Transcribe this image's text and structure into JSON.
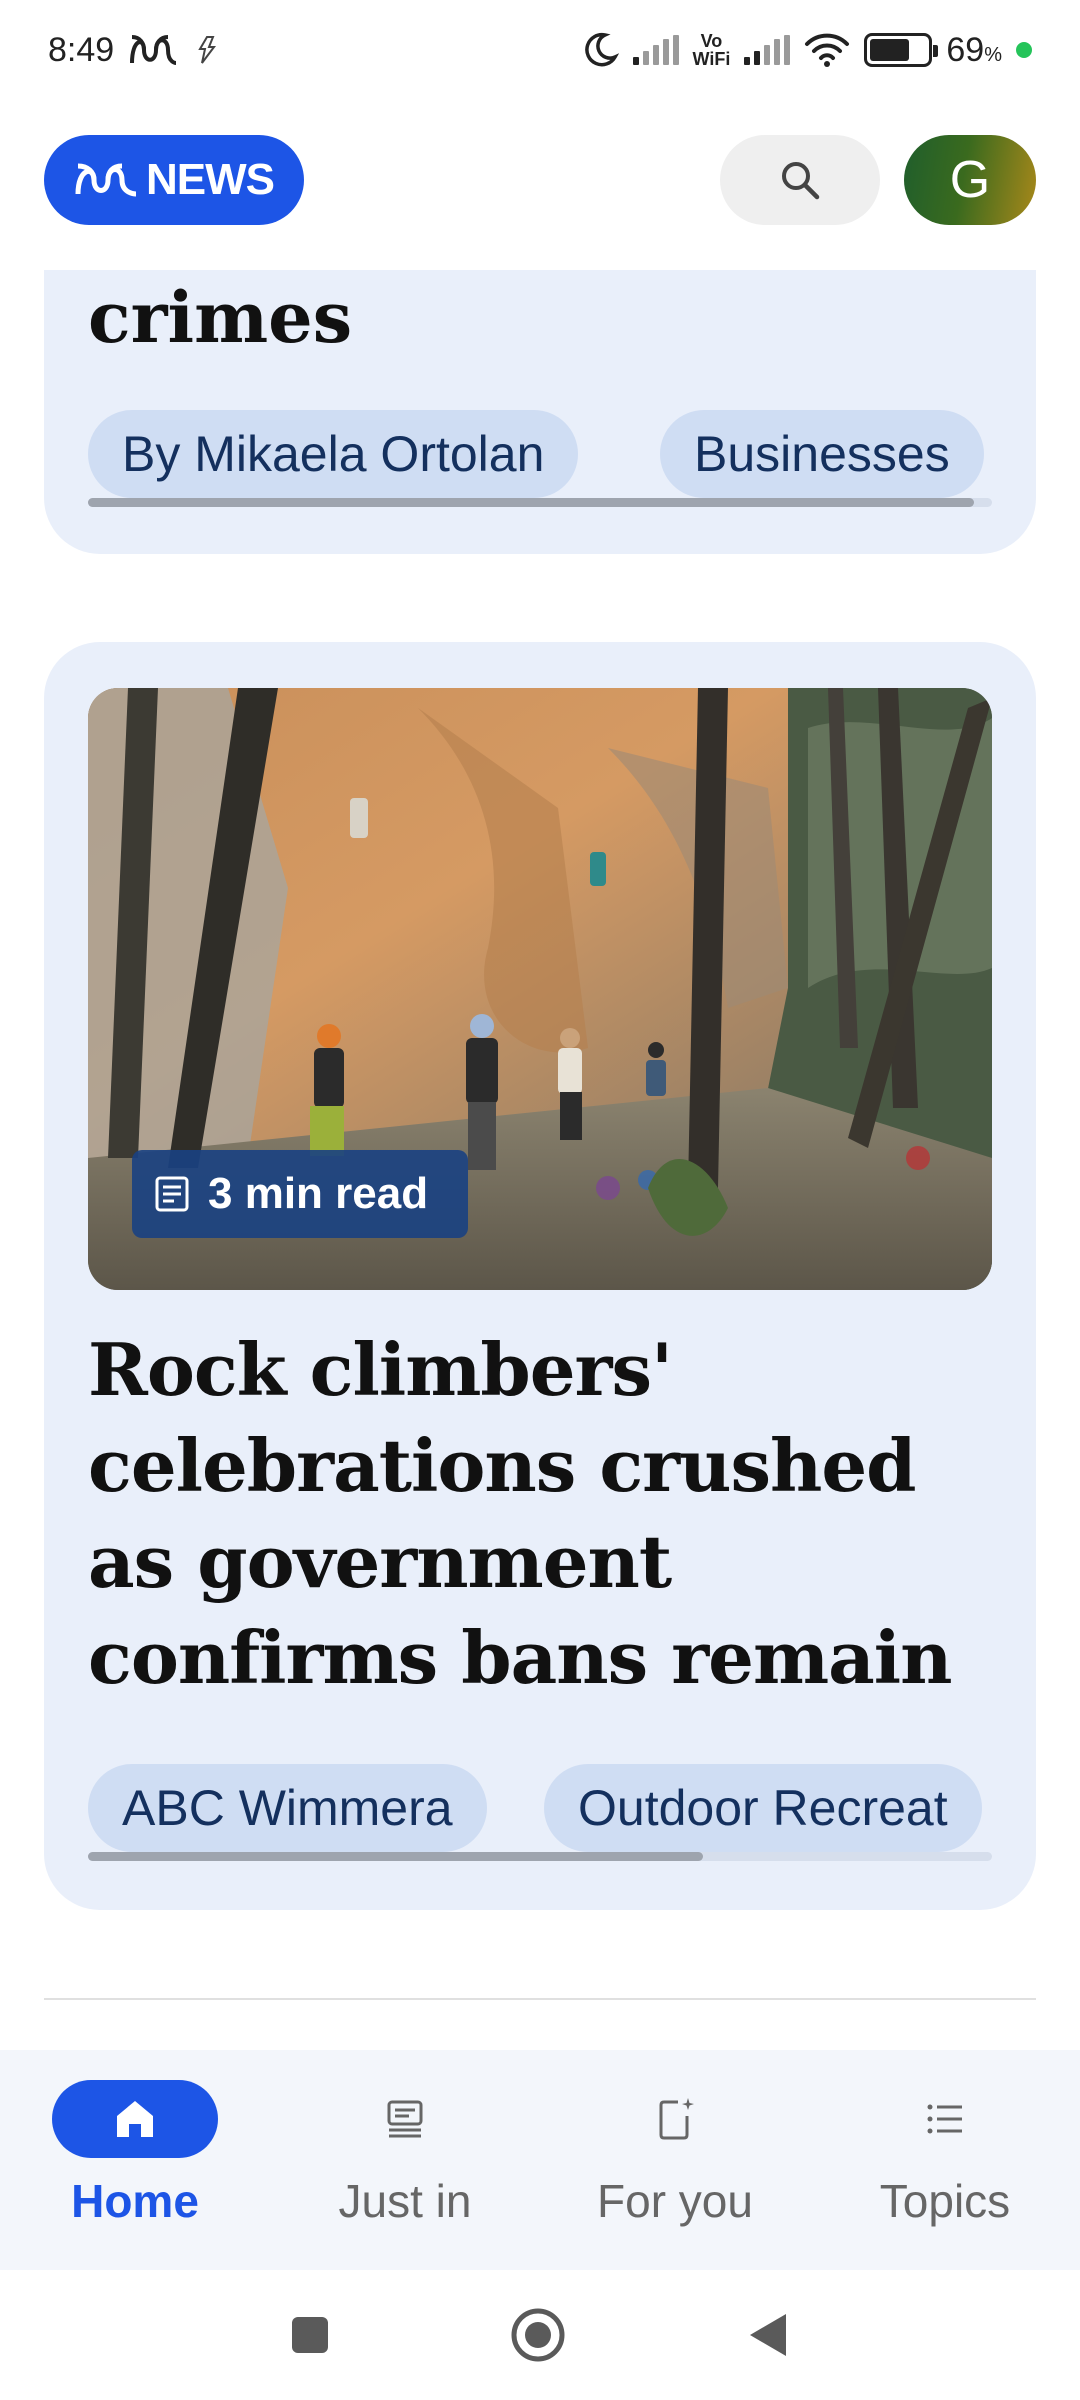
{
  "status_bar": {
    "time": "8:49",
    "vowifi_top": "Vo",
    "vowifi_bottom": "WiFi",
    "battery_level": 0.69,
    "battery_percent": "69",
    "percent_sign": "%"
  },
  "header": {
    "logo_text": "NEWS",
    "avatar_initial": "G"
  },
  "colors": {
    "brand_blue": "#1d55e6",
    "card_bg": "#e9effa",
    "chip_bg": "#cfddf3",
    "chip_text": "#14305e"
  },
  "icons": [
    "abc-logo-icon",
    "search-icon",
    "article-icon",
    "home-icon",
    "just-in-icon",
    "for-you-icon",
    "topics-icon",
    "recents-icon",
    "home-circle-icon",
    "back-icon"
  ],
  "feed": {
    "card1": {
      "title_fragment": "crimes",
      "tags": [
        "By Mikaela Ortolan",
        "Businesses"
      ],
      "scroll_position": 0.98
    },
    "card2": {
      "read_time": "3 min read",
      "headline": "Rock climbers' celebrations crushed as government confirms bans remain",
      "tags": [
        "ABC Wimmera",
        "Outdoor Recreat"
      ],
      "scroll_position": 0.68
    }
  },
  "bottom_nav": {
    "items": [
      {
        "label": "Home",
        "active": true
      },
      {
        "label": "Just in",
        "active": false
      },
      {
        "label": "For you",
        "active": false
      },
      {
        "label": "Topics",
        "active": false
      }
    ]
  }
}
